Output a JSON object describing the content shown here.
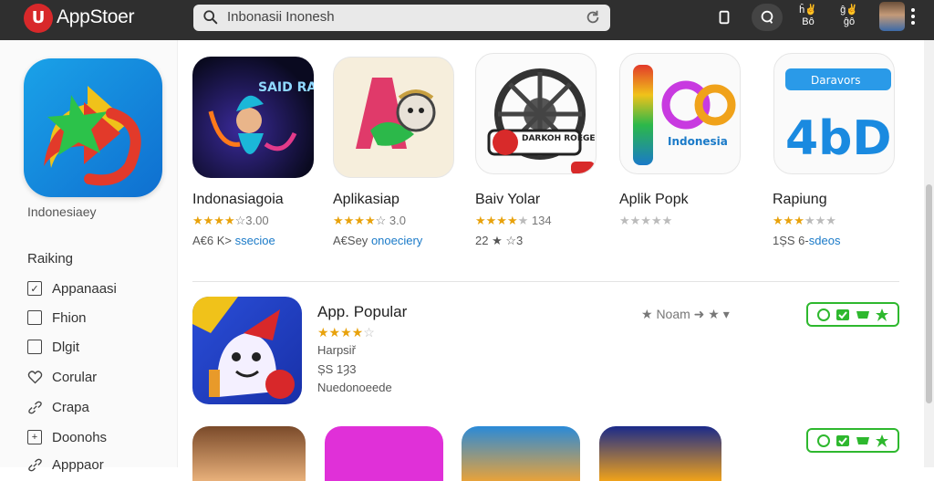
{
  "header": {
    "logo_text": "U",
    "app_title": "AppStoer",
    "search_value": "Inbonasii Inonesh",
    "btn_a_top": "ĥ✌",
    "btn_a_bottom": "Bô",
    "btn_b_top": "ĝ✌",
    "btn_b_bottom": "ĝô"
  },
  "sidebar": {
    "feature_label": "Indonesiaey",
    "heading": "Raiking",
    "items": [
      {
        "label": "Appanaasi",
        "icon": "checkbox-checked-icon"
      },
      {
        "label": "Fhion",
        "icon": "checkbox-icon"
      },
      {
        "label": "Dlgit",
        "icon": "checkbox-icon"
      },
      {
        "label": "Corular",
        "icon": "heart-icon"
      },
      {
        "label": "Crapa",
        "icon": "link-icon"
      },
      {
        "label": "Doonohs",
        "icon": "plus-box-icon"
      },
      {
        "label": "Apppaor",
        "icon": "link-icon"
      }
    ]
  },
  "cards": [
    {
      "title": "Indonasiagoia",
      "stars": "★★★★",
      "stars_gray": "",
      "rating": "☆3.00",
      "meta_a": "A€6 K>",
      "meta_b": "ssecioe"
    },
    {
      "title": "Aplikasiap",
      "stars": "★★★★",
      "stars_gray": "",
      "rating": "☆ 3.0",
      "meta_a": "A€Sey",
      "meta_b": "onoeciery"
    },
    {
      "title": "Baiv Yolar",
      "stars": "★★★★",
      "stars_gray": "★",
      "rating": "134",
      "meta_a": "22 ★ ☆3",
      "meta_b": ""
    },
    {
      "title": "Aplik Popk",
      "stars": "",
      "stars_gray": "★★★★★",
      "rating": "",
      "meta_a": "",
      "meta_b": ""
    },
    {
      "title": "Rapiung",
      "stars": "★★★",
      "stars_gray": "★★★",
      "rating": "",
      "meta_a": "1ȘS 6-",
      "meta_b": "sdeos"
    }
  ],
  "card_icon_text": {
    "c1": "SAID RAUS",
    "c3": "DARKOH ROEGE",
    "c4": "Indonesia",
    "c5_badge": "Daravors",
    "c5_big": "4bD"
  },
  "featured": {
    "title": "App. Popular",
    "stars": "★★★★",
    "stars_suffix": "☆",
    "line1": "Harpsiř",
    "line2": "ȘS 1Ȝ3",
    "line3": "Nuedonoeede",
    "action_text": "★  Noam  ➜  ★ ▾"
  },
  "colors": {
    "topbar": "#2f2f2f",
    "accent_red": "#d8282a",
    "star": "#e8a20c",
    "link_blue": "#1a7ac8",
    "install_green": "#2eb82e"
  }
}
